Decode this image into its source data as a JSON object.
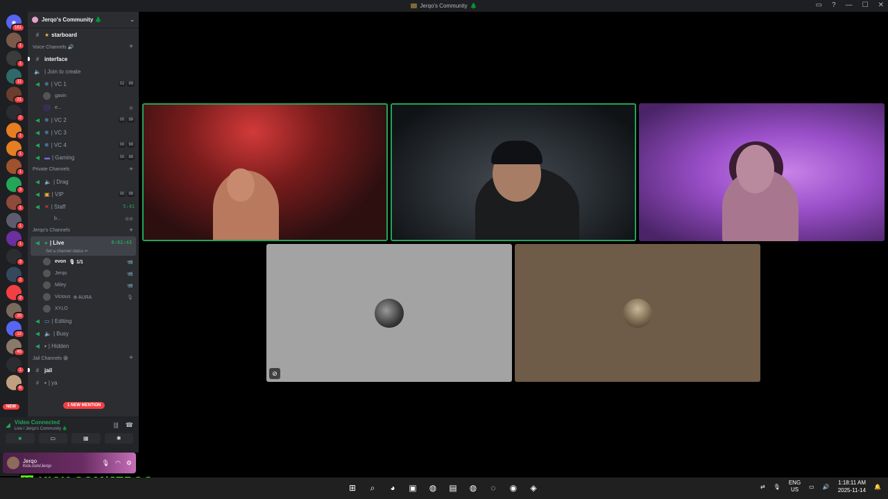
{
  "window": {
    "title": "Jerqo's Community",
    "title_emoji": "🌲",
    "controls": [
      "▭",
      "?",
      "—",
      "☐",
      "✕"
    ]
  },
  "guilds": [
    {
      "badge": "161",
      "color": "#5865f2",
      "glyph": "◉"
    },
    {
      "badge": "1",
      "color": "#7b5a4a",
      "glyph": ""
    },
    {
      "badge": "1",
      "color": "#3b3b3b",
      "glyph": ""
    },
    {
      "badge": "11",
      "color": "#2e6a6a",
      "glyph": ""
    },
    {
      "badge": "21",
      "color": "#6a3d2e",
      "glyph": ""
    },
    {
      "badge": "2",
      "color": "#2b2d31",
      "glyph": ""
    },
    {
      "badge": "1",
      "color": "#e67e22",
      "glyph": ""
    },
    {
      "badge": "1",
      "color": "#e67e22",
      "glyph": ""
    },
    {
      "badge": "1",
      "color": "#a0522d",
      "glyph": ""
    },
    {
      "badge": "3",
      "color": "#23a55a",
      "glyph": ""
    },
    {
      "badge": "1",
      "color": "#8e4a3a",
      "glyph": ""
    },
    {
      "badge": "1",
      "color": "#5c5c6e",
      "glyph": ""
    },
    {
      "badge": "1",
      "color": "#6b2fa0",
      "glyph": ""
    },
    {
      "badge": "3",
      "color": "#2b2d31",
      "glyph": ""
    },
    {
      "badge": "2",
      "color": "#34495e",
      "glyph": ""
    },
    {
      "badge": "2",
      "color": "#f23f43",
      "glyph": ""
    },
    {
      "badge": "20",
      "color": "#7a6a5a",
      "glyph": ""
    },
    {
      "badge": "12",
      "color": "#5865f2",
      "glyph": ""
    },
    {
      "badge": "45",
      "color": "#8a7a6a",
      "glyph": ""
    },
    {
      "badge": "1",
      "color": "#2b2d31",
      "glyph": ""
    },
    {
      "badge": "6",
      "color": "#c0a080",
      "glyph": ""
    }
  ],
  "new_pill": "NEW",
  "server": {
    "name": "Jerqo's Community 🌲"
  },
  "channels": {
    "starboard": "starboard",
    "voice_category": "Voice Channels 🔊",
    "interface": "interface",
    "join_to_create": "| Join to create",
    "vc1": "| VC 1",
    "vc1_counts": [
      "02",
      "99"
    ],
    "vc1_users": [
      "gavin",
      "e..."
    ],
    "vc2": "| VC 2",
    "vc2_counts": [
      "00",
      "99"
    ],
    "vc3": "| VC 3",
    "vc4": "| VC 4",
    "vc4_counts": [
      "00",
      "99"
    ],
    "gaming": "| Gaming",
    "gaming_counts": [
      "00",
      "99"
    ],
    "private_category": "Private Channels",
    "drag": "| Drag",
    "vip": "| VIP",
    "vip_counts": [
      "00",
      "99"
    ],
    "staff": "| Staff",
    "staff_timer": "5:41",
    "staff_user": "b...",
    "jerqo_category": "Jerqo's Channels",
    "live": "| Live",
    "live_timer": "6:02:43",
    "live_status": "Set a channel status ✏",
    "live_users": [
      {
        "name": "evon",
        "extra": "🎙 1/1",
        "bold": true,
        "right": "📹"
      },
      {
        "name": "Jerqo",
        "extra": "",
        "bold": false,
        "right": "📹"
      },
      {
        "name": "Miley",
        "extra": "",
        "bold": false,
        "right": "📹"
      },
      {
        "name": "Vicious",
        "extra": "⊕ AURA",
        "bold": false,
        "right": "🎙"
      },
      {
        "name": "XYLO",
        "extra": "",
        "bold": false,
        "right": ""
      }
    ],
    "editing": "| Editing",
    "busy": "| Busy",
    "hidden": "| Hidden",
    "jail_category": "Jail Channels 😁",
    "jail": "jail",
    "ya": "| ya"
  },
  "mention_pill": "1 NEW MENTION",
  "voice_panel": {
    "status": "Video Connected",
    "location": "Live / Jerqo's Community 🌲"
  },
  "user_panel": {
    "name": "Jerqo",
    "sub": "Kick.com/Jerqo"
  },
  "overlay": {
    "logo_letter": "K",
    "text": "KICK.COM/JERQO"
  },
  "taskbar": {
    "apps": [
      "⊞",
      "⌕",
      "◕",
      "▣",
      "◍",
      "▤",
      "◍",
      "◌",
      "◉",
      "◈"
    ],
    "lang": "ENG",
    "region": "US",
    "time": "1:18:11 AM",
    "date": "2025-11-14"
  }
}
